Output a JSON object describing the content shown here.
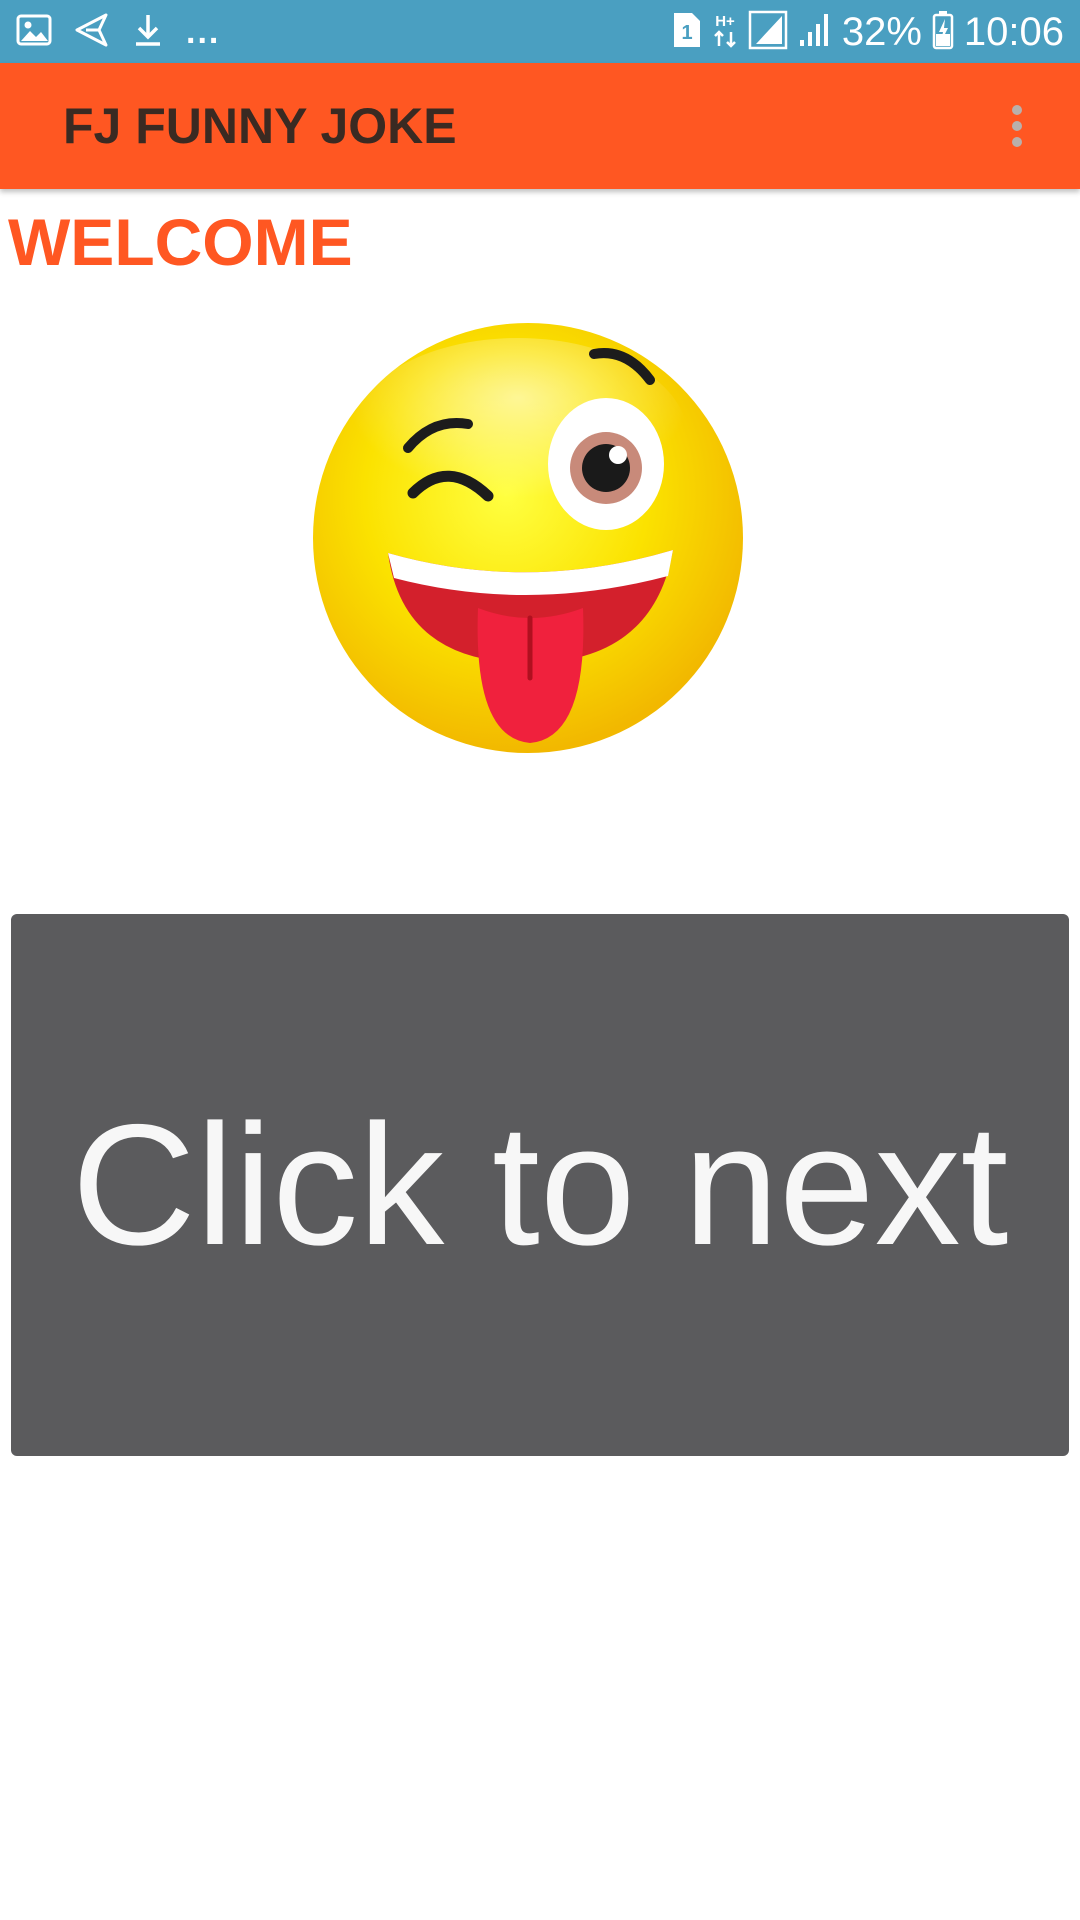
{
  "status_bar": {
    "left_icons": [
      "image-icon",
      "send-icon",
      "download-icon"
    ],
    "overflow_indicator": "...",
    "sim_label": "1",
    "network_type": "H+",
    "battery_percent": "32%",
    "time": "10:06",
    "background": "#4a9fc1"
  },
  "app_bar": {
    "title": "FJ FUNNY JOKE",
    "background": "#ff5722",
    "menu_icon": "more-vert-icon"
  },
  "main": {
    "welcome_text": "WELCOME",
    "welcome_color": "#ff5722",
    "emoji_icon": "winking-tongue-face-icon",
    "next_button_label": "Click to next",
    "next_button_color": "#5b5b5d"
  }
}
